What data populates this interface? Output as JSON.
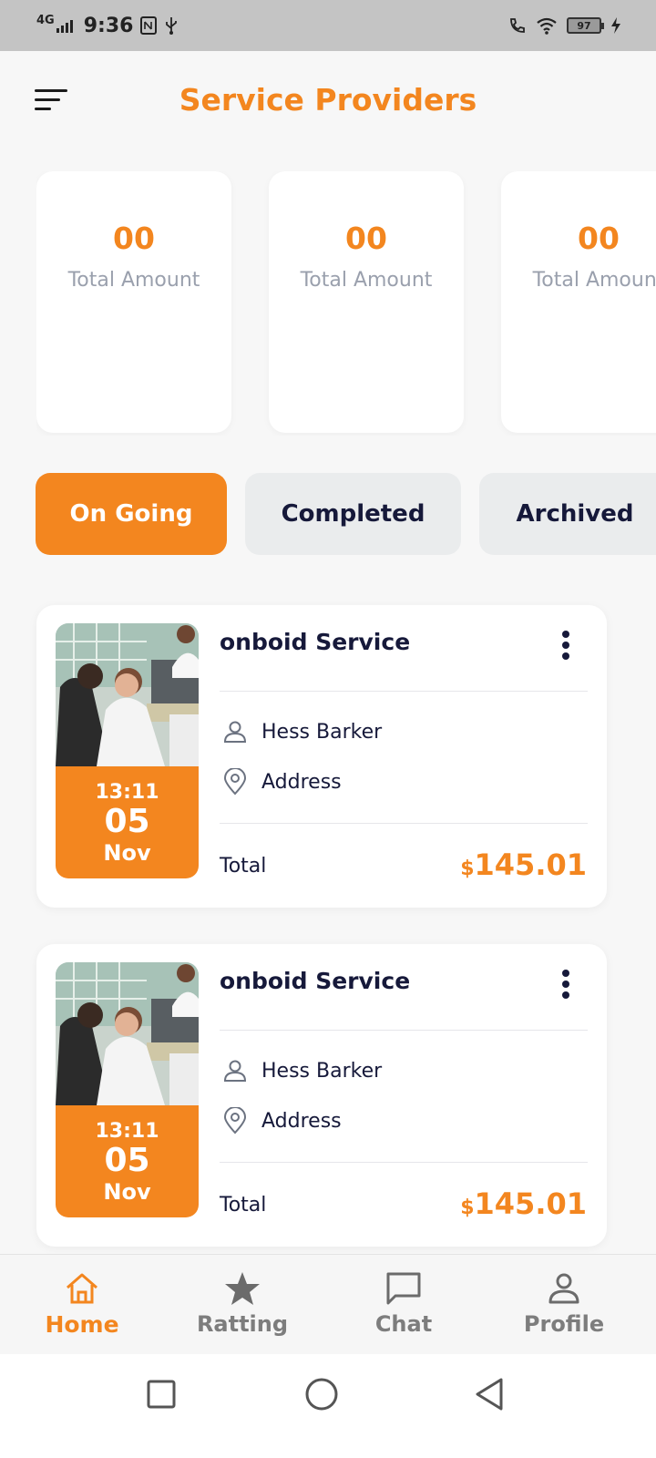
{
  "status_bar": {
    "network": "4G",
    "time": "9:36",
    "battery": "97"
  },
  "header": {
    "title": "Service Providers",
    "menu_icon": "menu-icon"
  },
  "stats": [
    {
      "value": "00",
      "label": "Total Amount"
    },
    {
      "value": "00",
      "label": "Total Amount"
    },
    {
      "value": "00",
      "label": "Total Amount"
    }
  ],
  "tabs": [
    {
      "label": "On Going",
      "active": true
    },
    {
      "label": "Completed",
      "active": false
    },
    {
      "label": "Archived",
      "active": false
    }
  ],
  "orders": [
    {
      "title": "onboid Service",
      "provider": "Hess Barker",
      "address": "Address",
      "time": "13:11",
      "day": "05",
      "month": "Nov",
      "total_label": "Total",
      "currency": "$",
      "amount": "145.01"
    },
    {
      "title": "onboid Service",
      "provider": "Hess Barker",
      "address": "Address",
      "time": "13:11",
      "day": "05",
      "month": "Nov",
      "total_label": "Total",
      "currency": "$",
      "amount": "145.01"
    }
  ],
  "bottom_nav": [
    {
      "label": "Home",
      "icon": "home-icon",
      "active": true
    },
    {
      "label": "Ratting",
      "icon": "star-icon",
      "active": false
    },
    {
      "label": "Chat",
      "icon": "chat-icon",
      "active": false
    },
    {
      "label": "Profile",
      "icon": "profile-icon",
      "active": false
    }
  ],
  "colors": {
    "accent": "#f3861f",
    "text_dark": "#16193a",
    "muted": "#9aa0ad",
    "background": "#f7f7f7"
  }
}
